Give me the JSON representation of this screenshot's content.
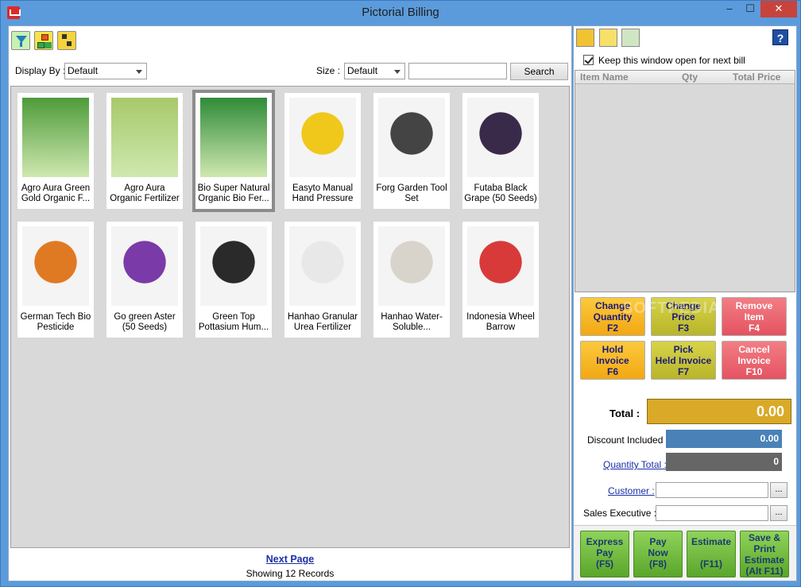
{
  "window": {
    "title": "Pictorial Billing",
    "minimize": "–",
    "maximize": "☐",
    "close": "✕"
  },
  "filters": {
    "display_by_label": "Display By :",
    "display_by_value": "Default",
    "size_label": "Size :",
    "size_value": "Default",
    "search_value": "",
    "search_button": "Search"
  },
  "products": [
    {
      "name": "Agro Aura Green Gold Organic F...",
      "icon": "fertilizer-bag-green-icon",
      "color": "#4e9b3a"
    },
    {
      "name": "Agro Aura Organic Fertilizer",
      "icon": "fertilizer-bag-white-icon",
      "color": "#a7c96a"
    },
    {
      "name": "Bio Super Natural Organic Bio Fer...",
      "icon": "bio-super-bag-icon",
      "color": "#2f8b38"
    },
    {
      "name": "Easyto Manual Hand Pressure",
      "icon": "sprayer-icon",
      "color": "#f0c81c"
    },
    {
      "name": "Forg Garden Tool Set",
      "icon": "garden-tools-icon",
      "color": "#444444"
    },
    {
      "name": "Futaba Black Grape (50 Seeds)",
      "icon": "black-grape-icon",
      "color": "#3a2a4a"
    },
    {
      "name": "German Tech Bio Pesticide",
      "icon": "pesticide-bottle-icon",
      "color": "#e07a22"
    },
    {
      "name": "Go green Aster (50 Seeds)",
      "icon": "aster-flowers-icon",
      "color": "#7a3aa8"
    },
    {
      "name": "Green Top Pottasium Hum...",
      "icon": "potassium-granules-icon",
      "color": "#2a2a2a"
    },
    {
      "name": "Hanhao Granular Urea Fertilizer",
      "icon": "urea-granules-icon",
      "color": "#e8e8e8"
    },
    {
      "name": "Hanhao Water-Soluble...",
      "icon": "water-soluble-fertilizer-icon",
      "color": "#d8d4cc"
    },
    {
      "name": "Indonesia Wheel Barrow",
      "icon": "wheelbarrow-icon",
      "color": "#d83a3a"
    }
  ],
  "pager": {
    "next_page": "Next Page",
    "records": "Showing 12 Records"
  },
  "bill": {
    "keep_open_label": "Keep this window open for next bill",
    "columns": [
      "Item Name",
      "Qty",
      "Total Price"
    ]
  },
  "actions": [
    {
      "label1": "Change",
      "label2": "Quantity",
      "key": "F2"
    },
    {
      "label1": "Change",
      "label2": "Price",
      "key": "F3"
    },
    {
      "label1": "Remove",
      "label2": "Item",
      "key": "F4"
    },
    {
      "label1": "Hold",
      "label2": "Invoice",
      "key": "F6"
    },
    {
      "label1": "Pick",
      "label2": "Held Invoice",
      "key": "F7"
    },
    {
      "label1": "Cancel",
      "label2": "Invoice",
      "key": "F10"
    }
  ],
  "totals": {
    "total_label": "Total :",
    "total_value": "0.00",
    "discount_label": "Discount Included :",
    "discount_value": "0.00",
    "quantity_label": "Quantity Total :",
    "quantity_value": "0",
    "customer_label": "Customer :",
    "customer_value": "",
    "sales_exec_label": "Sales Executive :",
    "sales_exec_value": "",
    "browse_button": "..."
  },
  "payments": [
    {
      "l1": "Express",
      "l2": "Pay",
      "l3": "(F5)"
    },
    {
      "l1": "Pay",
      "l2": "Now",
      "l3": "(F8)"
    },
    {
      "l1": "Estimate",
      "l2": "",
      "l3": "(F11)"
    },
    {
      "l1": "Save &",
      "l2": "Print",
      "l3": "Estimate",
      "l4": "(Alt F11)"
    }
  ],
  "help": "?",
  "watermark": "SOFTPEDIA"
}
